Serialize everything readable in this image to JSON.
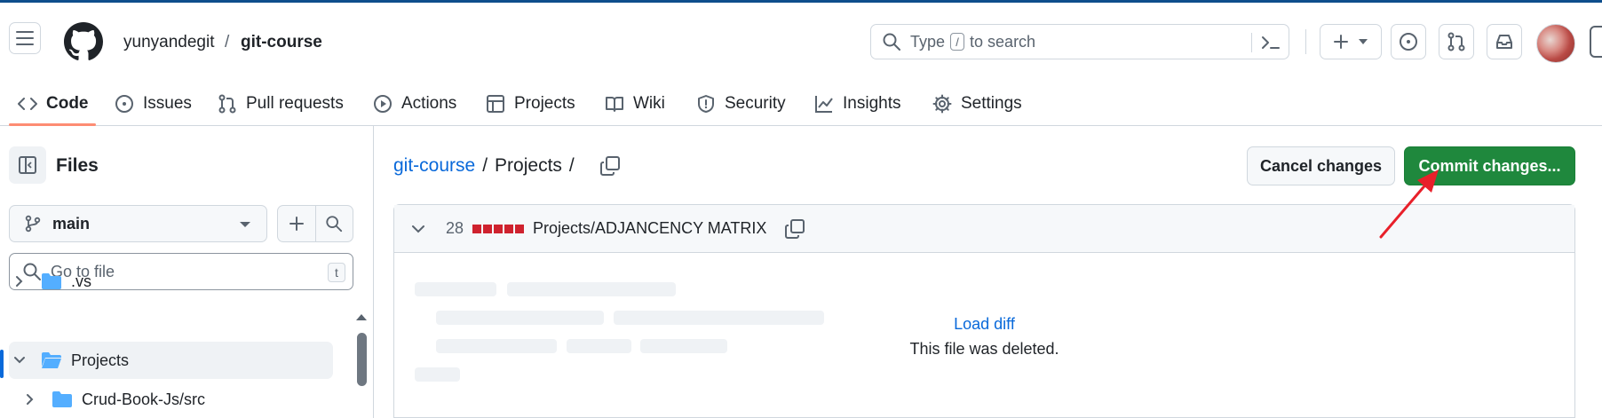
{
  "header": {
    "owner": "yunyandegit",
    "separator": "/",
    "repo": "git-course",
    "search": {
      "prefix": "Type",
      "key": "/",
      "suffix": "to search"
    }
  },
  "nav": {
    "tabs": [
      {
        "label": "Code",
        "icon": "code-icon",
        "active": true
      },
      {
        "label": "Issues",
        "icon": "issue-icon"
      },
      {
        "label": "Pull requests",
        "icon": "pull-request-icon"
      },
      {
        "label": "Actions",
        "icon": "play-icon"
      },
      {
        "label": "Projects",
        "icon": "table-icon"
      },
      {
        "label": "Wiki",
        "icon": "book-icon"
      },
      {
        "label": "Security",
        "icon": "shield-icon"
      },
      {
        "label": "Insights",
        "icon": "graph-icon"
      },
      {
        "label": "Settings",
        "icon": "gear-icon"
      }
    ]
  },
  "sidebar": {
    "title": "Files",
    "branch": "main",
    "goto_placeholder": "Go to file",
    "goto_key": "t",
    "tree": [
      {
        "name": ".vs",
        "expanded": false,
        "selected": false
      },
      {
        "name": "Projects",
        "expanded": true,
        "selected": true
      },
      {
        "name": "Crud-Book-Js/src",
        "expanded": false,
        "selected": false
      }
    ]
  },
  "main": {
    "breadcrumb": {
      "repo": "git-course",
      "sep1": "/",
      "folder": "Projects",
      "sep2": "/"
    },
    "cancel_label": "Cancel changes",
    "commit_label": "Commit changes...",
    "diff": {
      "count": "28",
      "path": "Projects/ADJANCENCY MATRIX",
      "load_label": "Load diff",
      "message": "This file was deleted."
    }
  },
  "colors": {
    "accent": "#0969da",
    "commit_green": "#1f883d",
    "deleted_red": "#cf222e",
    "tab_underline": "#fd8c73",
    "annotation_arrow": "#e8202a"
  }
}
